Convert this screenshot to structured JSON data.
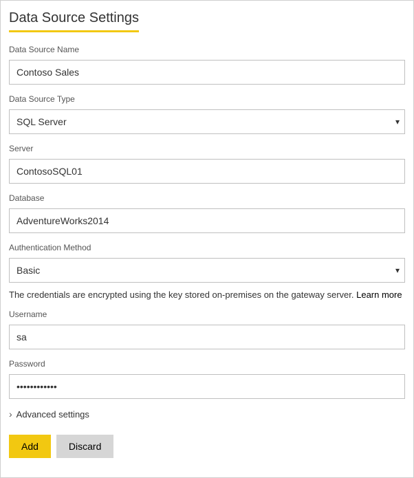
{
  "title": "Data Source Settings",
  "fields": {
    "dataSourceName": {
      "label": "Data Source Name",
      "value": "Contoso Sales"
    },
    "dataSourceType": {
      "label": "Data Source Type",
      "value": "SQL Server"
    },
    "server": {
      "label": "Server",
      "value": "ContosoSQL01"
    },
    "database": {
      "label": "Database",
      "value": "AdventureWorks2014"
    },
    "authMethod": {
      "label": "Authentication Method",
      "value": "Basic"
    },
    "username": {
      "label": "Username",
      "value": "sa"
    },
    "password": {
      "label": "Password",
      "value": "••••••••••••"
    }
  },
  "info": {
    "text": "The credentials are encrypted using the key stored on-premises on the gateway server. ",
    "linkText": "Learn more"
  },
  "advanced": {
    "label": "Advanced settings"
  },
  "buttons": {
    "add": "Add",
    "discard": "Discard"
  }
}
